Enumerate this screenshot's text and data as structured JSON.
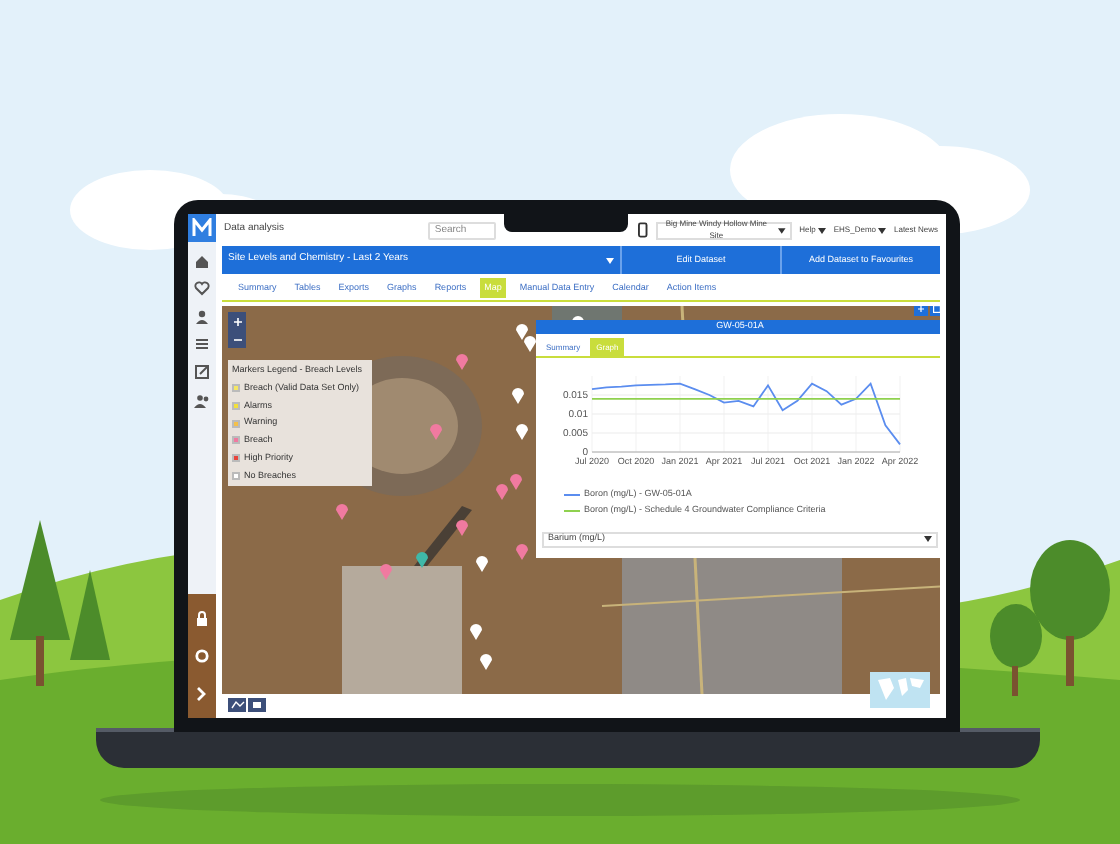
{
  "app_bar": {
    "title": "Data analysis",
    "search": {
      "placeholder": "Search"
    },
    "site": "Big Mine Windy Hollow Mine Site",
    "menus": [
      {
        "label": "Help",
        "dropdown": true
      },
      {
        "label": "EHS_Demo",
        "dropdown": true
      },
      {
        "label": "Latest News",
        "dropdown": false
      }
    ]
  },
  "dataset_bar": {
    "title": "Site Levels and Chemistry - Last 2 Years",
    "actions": [
      "Edit Dataset",
      "Add Dataset to Favourites"
    ]
  },
  "tabs": [
    {
      "label": "Summary",
      "selected": false
    },
    {
      "label": "Tables",
      "selected": false
    },
    {
      "label": "Exports",
      "selected": false
    },
    {
      "label": "Graphs",
      "selected": false
    },
    {
      "label": "Reports",
      "selected": false
    },
    {
      "label": "Map",
      "selected": true
    },
    {
      "label": "Manual Data Entry",
      "selected": false
    },
    {
      "label": "Calendar",
      "selected": false
    },
    {
      "label": "Action Items",
      "selected": false
    }
  ],
  "legend": {
    "title": "Markers Legend - Breach Levels",
    "items": [
      {
        "label": "Breach (Valid Data Set Only)",
        "color": "#f5e663"
      },
      {
        "label": "Alarms",
        "color": "#f2e03a"
      },
      {
        "label": "Warning",
        "color": "#f4c04a"
      },
      {
        "label": "Breach",
        "color": "#f07aa0"
      },
      {
        "label": "High Priority",
        "color": "#e8433a"
      },
      {
        "label": "No Breaches",
        "color": "#ffffff"
      }
    ]
  },
  "popup": {
    "title": "GW-05-01A",
    "tabs": [
      {
        "label": "Summary",
        "selected": false
      },
      {
        "label": "Graph",
        "selected": true
      }
    ],
    "chart_data": {
      "type": "line",
      "categories": [
        "Jul 2020",
        null,
        null,
        "Oct 2020",
        null,
        null,
        "Jan 2021",
        null,
        null,
        "Apr 2021",
        null,
        null,
        "Jul 2021",
        null,
        null,
        "Oct 2021",
        null,
        null,
        "Jan 2022",
        null,
        null,
        "Apr 2022"
      ],
      "ylim": [
        0,
        0.02
      ],
      "grid": true,
      "legend": true,
      "yticks": [
        0,
        0.005,
        0.01,
        0.015
      ],
      "series": [
        {
          "name": "Boron (mg/L) - GW-05-01A",
          "color": "#5b8def",
          "values": [
            0.0165,
            0.017,
            0.0172,
            0.0175,
            0.0177,
            0.0178,
            0.018,
            0.0165,
            0.015,
            0.013,
            0.0135,
            0.012,
            0.0175,
            0.011,
            0.0135,
            0.018,
            0.016,
            0.0125,
            0.014,
            0.018,
            0.007,
            0.002
          ]
        },
        {
          "name": "Boron (mg/L) - Schedule 4 Groundwater Compliance Criteria",
          "color": "#8fd14f",
          "values": [
            0.014,
            0.014,
            0.014,
            0.014,
            0.014,
            0.014,
            0.014,
            0.014,
            0.014,
            0.014,
            0.014,
            0.014,
            0.014,
            0.014,
            0.014,
            0.014,
            0.014,
            0.014,
            0.014,
            0.014,
            0.014,
            0.014
          ]
        }
      ]
    },
    "select": "Barium (mg/L)"
  }
}
